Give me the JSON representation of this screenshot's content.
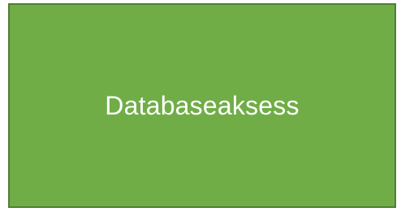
{
  "diagram": {
    "box": {
      "label": "Databaseaksess",
      "fill_color": "#70ad47",
      "border_color": "#507e32",
      "text_color": "#ffffff"
    }
  }
}
